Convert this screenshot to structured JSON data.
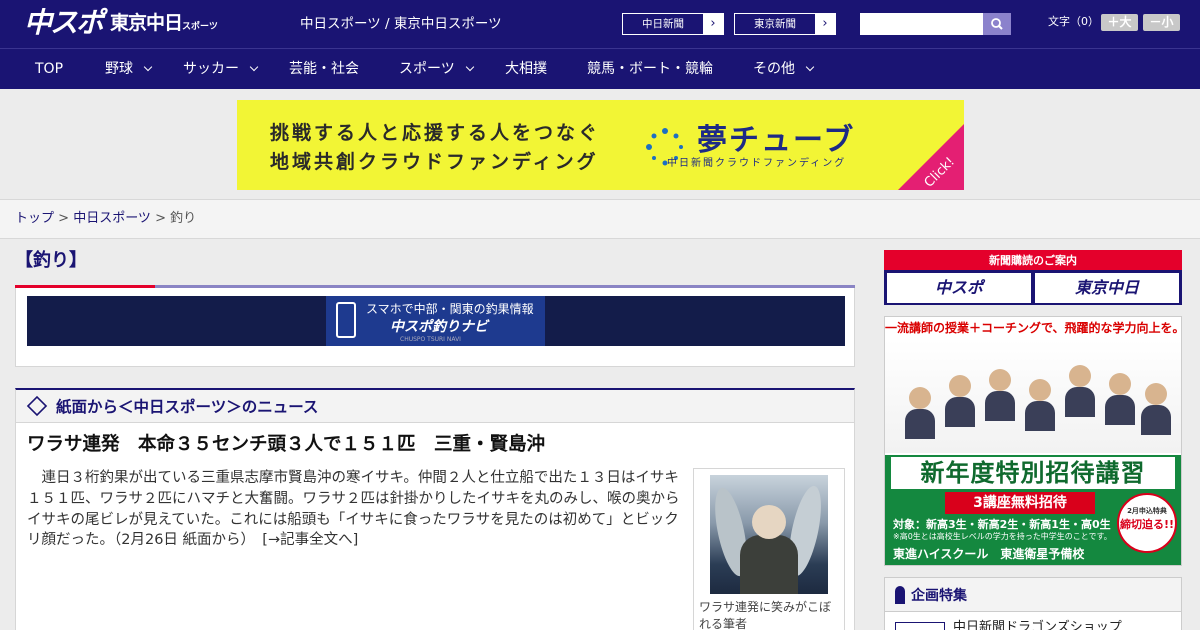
{
  "header": {
    "logo_chuspo": "中スポ",
    "logo_tokyo": "東京中日",
    "logo_tokyo_sub": "スポーツ",
    "site_links": "中日スポーツ / 東京中日スポーツ",
    "btn_chunichi": "中日新聞",
    "btn_tokyo": "東京新聞",
    "btn_arrow": "›",
    "search_placeholder": "",
    "font_label": "文字（0）",
    "font_larger": "＋大",
    "font_smaller": "－小"
  },
  "nav": {
    "items": [
      {
        "label": "TOP"
      },
      {
        "label": "野球"
      },
      {
        "label": "サッカー"
      },
      {
        "label": "芸能・社会"
      },
      {
        "label": "スポーツ"
      },
      {
        "label": "大相撲"
      },
      {
        "label": "競馬・ボート・競輪"
      },
      {
        "label": "その他"
      }
    ]
  },
  "banner": {
    "line1": "挑戦する人と応援する人をつなぐ",
    "line2": "地域共創クラウドファンディング",
    "logo": "夢チューブ",
    "sub": "中日新聞クラウドファンディング",
    "click": "Click!"
  },
  "breadcrumb": {
    "top": "トップ",
    "sep": " > ",
    "parent": "中日スポーツ",
    "current": "釣り"
  },
  "main": {
    "section_title": "【釣り】",
    "navi_line1": "スマホで中部・関東の釣果情報",
    "navi_line2": "中スポ釣りナビ",
    "navi_line3": "CHUSPO TSURI NAVI",
    "news_header": "紙面から＜中日スポーツ＞のニュース",
    "headline": "ワラサ連発　本命３５センチ頭３人で１５１匹　三重・賢島沖",
    "body": "　連日３桁釣果が出ている三重県志摩市賢島沖の寒イサキ。仲間２人と仕立船で出た１３日はイサキ１５１匹、ワラサ２匹にハマチと大奮闘。ワラサ２匹は針掛かりしたイサキを丸のみし、喉の奥からイサキの尾ビレが見えていた。これには船頭も「イサキに食ったワラサを見たのは初めて」とビックリ顔だった。（2月26日 紙面から）　",
    "more": "[→記事全文へ]",
    "caption": "ワラサ連発に笑みがこぼれる筆者"
  },
  "sidebar": {
    "subscribe_head": "新聞購読のご案内",
    "sub_chuspo": "中スポ",
    "sub_tokyo": "東京中日",
    "ad_top": "一流講師の授業＋コーチングで、飛躍的な学力向上を。",
    "ad_big": "新年度特別招待講習",
    "ad_red": "3講座無料招待",
    "ad_target": "対象：新高3生・新高2生・新高1生・高0生",
    "ad_note": "※高0生とは高校生レベルの学力を持った中学生のことです。",
    "ad_brand1": "東進ハイスクール",
    "ad_brand2": "東進衛星予備校",
    "ad_badge_small": "2月申込特典",
    "ad_badge": "締切迫る!!",
    "feature_head": "企画特集",
    "feature_item": "中日新聞ドラゴンズショップ"
  },
  "colors": {
    "brand_navy": "#1a1473",
    "accent_red": "#e4002b",
    "banner_yellow": "#f2f535",
    "ad_green": "#14883f"
  }
}
